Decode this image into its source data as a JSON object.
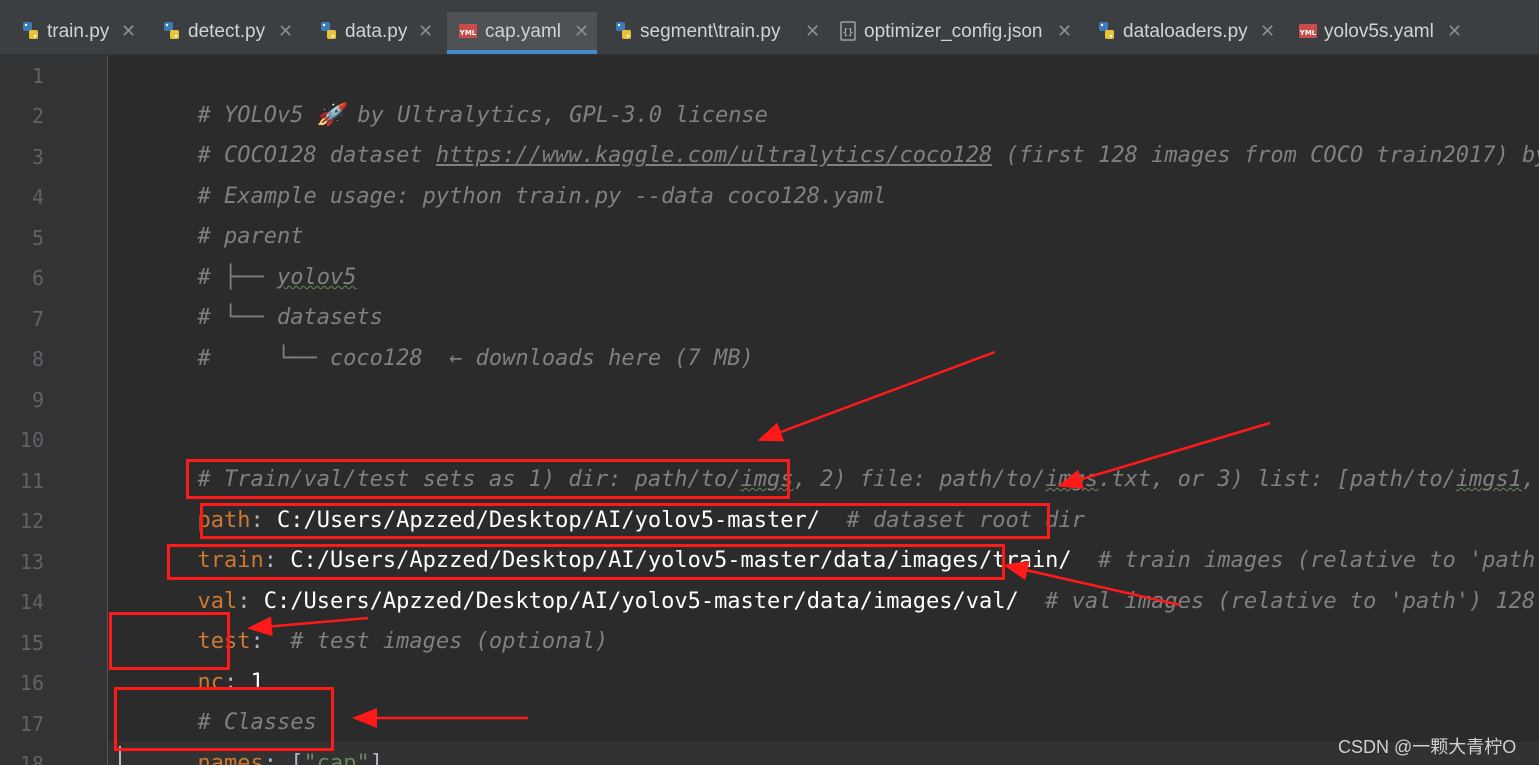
{
  "tabs": [
    {
      "label": "train.py",
      "icon": "python-file-icon",
      "active": false
    },
    {
      "label": "detect.py",
      "icon": "python-file-icon",
      "active": false
    },
    {
      "label": "data.py",
      "icon": "python-file-icon",
      "active": false
    },
    {
      "label": "cap.yaml",
      "icon": "yaml-file-icon",
      "active": true
    },
    {
      "label": "segment\\train.py",
      "icon": "python-file-icon",
      "active": false
    },
    {
      "label": "optimizer_config.json",
      "icon": "json-file-icon",
      "active": false
    },
    {
      "label": "dataloaders.py",
      "icon": "python-file-icon",
      "active": false
    },
    {
      "label": "yolov5s.yaml",
      "icon": "yaml-file-icon",
      "active": false
    }
  ],
  "close_glyph": "✕",
  "line_numbers": [
    "1",
    "2",
    "3",
    "4",
    "5",
    "6",
    "7",
    "8",
    "9",
    "10",
    "11",
    "12",
    "13",
    "14",
    "15",
    "16",
    "17",
    "18"
  ],
  "code": {
    "l1": "# YOLOv5 🚀 by Ultralytics, GPL-3.0 license",
    "l2a": "# COCO128 dataset ",
    "l2_link": "https://www.kaggle.com/ultralytics/coco128",
    "l2b": " (first 128 images from COCO train2017) by",
    "l3": "# Example usage: python train.py --data coco128.yaml",
    "l4": "# parent",
    "l5a": "# ├── ",
    "l5b": "yolov5",
    "l6": "# └── datasets",
    "l7": "#     └── coco128  ← downloads here (7 MB)",
    "l10a": "# Train/val/test sets as 1) dir: path/to/",
    "l10_imgs1": "imgs",
    "l10b": ", 2) file: path/to/",
    "l10_imgs2": "imgs",
    "l10c": ".txt, or 3) list: [path/to/",
    "l10_imgs3": "imgs1",
    "l10d": ",",
    "l11_key": "path",
    "l11_colon": ":",
    "l11_val": " C:/Users/Apzzed/Desktop/AI/yolov5-master/",
    "l11_cm": "  # dataset root dir",
    "l12_key": "train",
    "l12_colon": ":",
    "l12_val": " C:/Users/Apzzed/Desktop/AI/yolov5-master/data/images/train/",
    "l12_cm": "  # train images (relative to 'path",
    "l13_key": "val",
    "l13_colon": ":",
    "l13_val": " C:/Users/Apzzed/Desktop/AI/yolov5-master/data/images/val/",
    "l13_cm": "  # val images (relative to 'path') 128",
    "l14_key": "test",
    "l14_colon": ":",
    "l14_cm": "  # test images (optional)",
    "l15_key": "nc",
    "l15_colon": ": ",
    "l15_val": "1",
    "l16": "# Classes",
    "l17_key": "names",
    "l17_colon": ": [",
    "l17_str": "\"cap\"",
    "l17_end": "]"
  },
  "watermark": "CSDN @一颗大青柠O",
  "annotation_color": "#ff1a1a"
}
